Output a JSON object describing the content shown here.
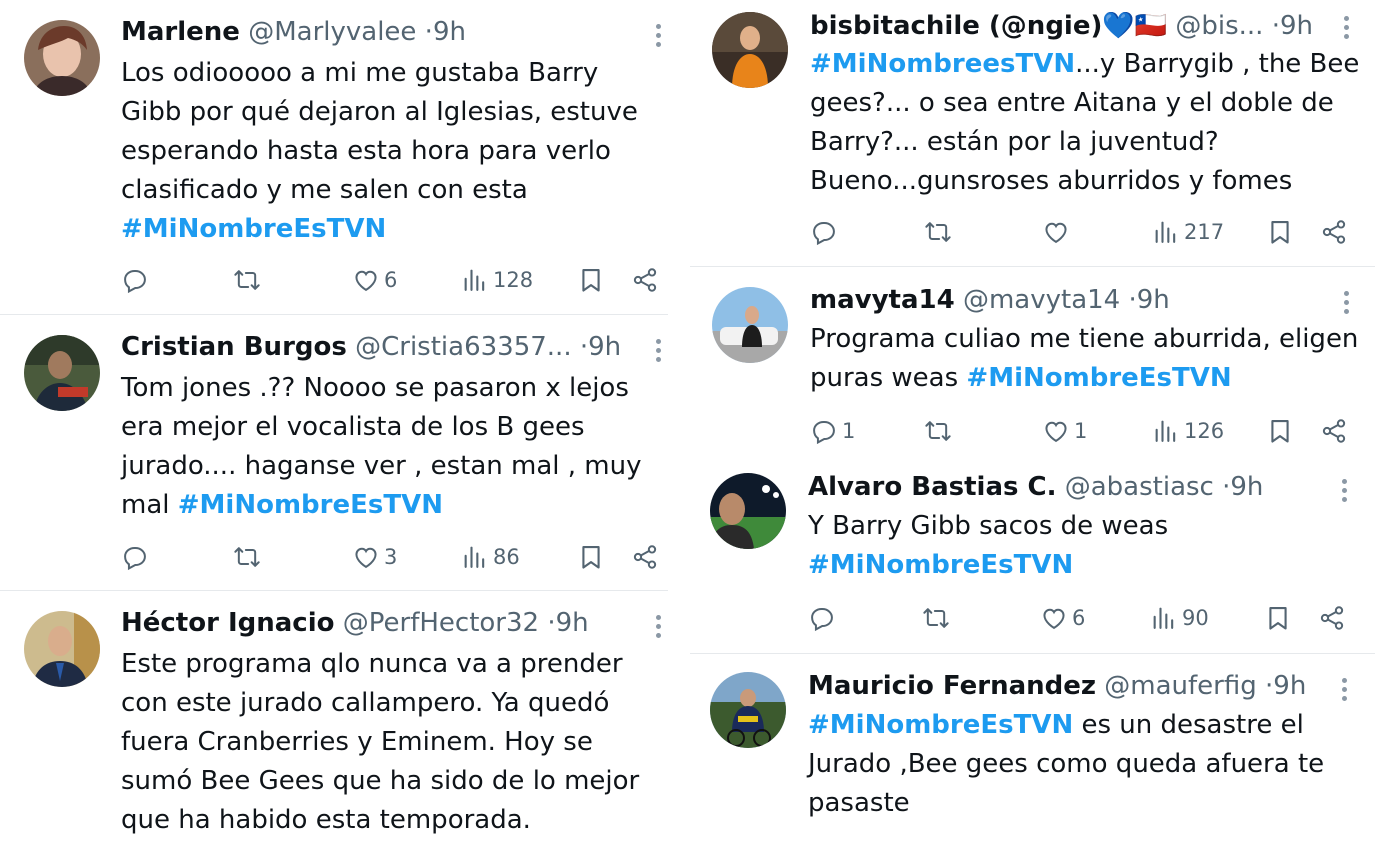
{
  "hashtag": "#MiNombreEsTVN",
  "colors": {
    "accent": "#1d9bf0",
    "text": "#0f1419",
    "muted": "#536471"
  },
  "left_column": [
    {
      "name": "Marlene",
      "handle": "@Marlyvalee",
      "time": "9h",
      "text": "Los odiooooo a mi me gustaba Barry Gibb por qué dejaron al Iglesias, estuve esperando hasta esta hora para verlo clasificado y me salen con esta",
      "hashtag": "#MiNombreEsTVN",
      "replies": "",
      "retweets": "",
      "likes": "6",
      "views": "128"
    },
    {
      "name": "Cristian Burgos",
      "handle": "@Cristia63357...",
      "time": "9h",
      "text": "Tom jones .?? Noooo se pasaron x lejos era mejor el vocalista de los B gees jurado.... haganse ver , estan mal , muy mal",
      "hashtag": "#MiNombreEsTVN",
      "replies": "",
      "retweets": "",
      "likes": "3",
      "views": "86"
    },
    {
      "name": "Héctor Ignacio",
      "handle": "@PerfHector32",
      "time": "9h",
      "text": "Este programa qlo nunca va a prender con este jurado callampero. Ya quedó fuera Cranberries y Eminem. Hoy se sumó Bee Gees que ha sido de lo mejor que ha habido esta temporada."
    }
  ],
  "right_column": [
    {
      "name": "bisbitachile (@ngie)💙🇨🇱",
      "handle": "@bis...",
      "time": "9h",
      "hashtag": "#MiNombreesTVN",
      "text": "...y Barrygib , the Bee gees?... o sea entre Aitana y el doble de Barry?... están por la juventud? Bueno...gunsroses aburridos y fomes",
      "replies": "",
      "retweets": "",
      "likes": "",
      "views": "217"
    },
    {
      "name": "mavyta14",
      "handle": "@mavyta14",
      "time": "9h",
      "text": "Programa culiao me tiene aburrida, eligen puras weas",
      "hashtag": "#MiNombreEsTVN",
      "replies": "1",
      "retweets": "",
      "likes": "1",
      "views": "126"
    },
    {
      "name": "Alvaro Bastias C.",
      "handle": "@abastiasc",
      "time": "9h",
      "text": "Y Barry Gibb sacos de weas",
      "hashtag": "#MiNombreEsTVN",
      "replies": "",
      "retweets": "",
      "likes": "6",
      "views": "90"
    },
    {
      "name": "Mauricio Fernandez",
      "handle": "@mauferfig",
      "time": "9h",
      "hashtag": "#MiNombreEsTVN",
      "text": "es un desastre el Jurado ,Bee gees como queda afuera te pasaste"
    }
  ]
}
